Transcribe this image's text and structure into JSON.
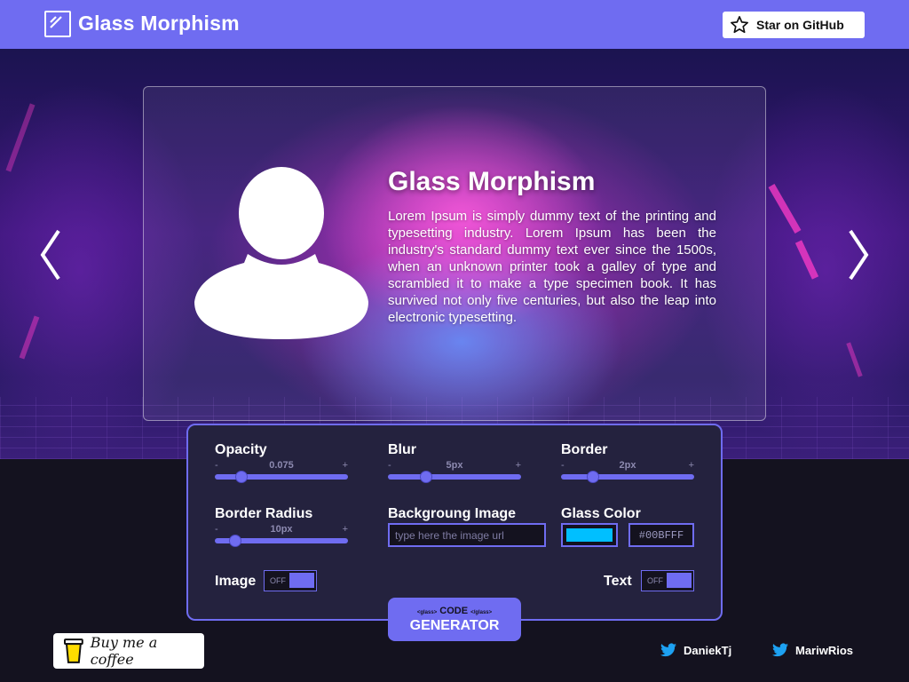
{
  "header": {
    "brand": "Glass Morphism",
    "github_button": "Star on GitHub"
  },
  "card": {
    "title": "Glass Morphism",
    "text": "Lorem Ipsum is simply dummy text of the printing and typesetting industry. Lorem Ipsum has been the industry's standard dummy text ever since the 1500s, when an unknown printer took a galley of type and scrambled it to make a type specimen book. It has survived not only five centuries, but also the leap into electronic typesetting."
  },
  "controls": {
    "opacity": {
      "label": "Opacity",
      "value": "0.075",
      "min_sign": "-",
      "max_sign": "+"
    },
    "blur": {
      "label": "Blur",
      "value": "5px",
      "min_sign": "-",
      "max_sign": "+"
    },
    "border": {
      "label": "Border",
      "value": "2px",
      "min_sign": "-",
      "max_sign": "+"
    },
    "border_radius": {
      "label": "Border Radius",
      "value": "10px",
      "min_sign": "-",
      "max_sign": "+"
    },
    "background_image": {
      "label": "Backgroung Image",
      "placeholder": "type here the image url"
    },
    "glass_color": {
      "label": "Glass Color",
      "hex": "#00BFFF",
      "swatch": "#00bfff"
    },
    "image_toggle": {
      "label": "Image",
      "state": "OFF"
    },
    "text_toggle": {
      "label": "Text",
      "state": "OFF"
    }
  },
  "generator": {
    "tag_open": "<glass>",
    "code": "CODE",
    "tag_close": "</glass>",
    "label": "GENERATOR"
  },
  "footer": {
    "coffee": "Buy me a coffee",
    "twitter_1": "DaniekTj",
    "twitter_2": "MariwRios"
  },
  "colors": {
    "accent": "#6f6cf1",
    "panel": "#24223e",
    "page_bg": "#14121f"
  }
}
